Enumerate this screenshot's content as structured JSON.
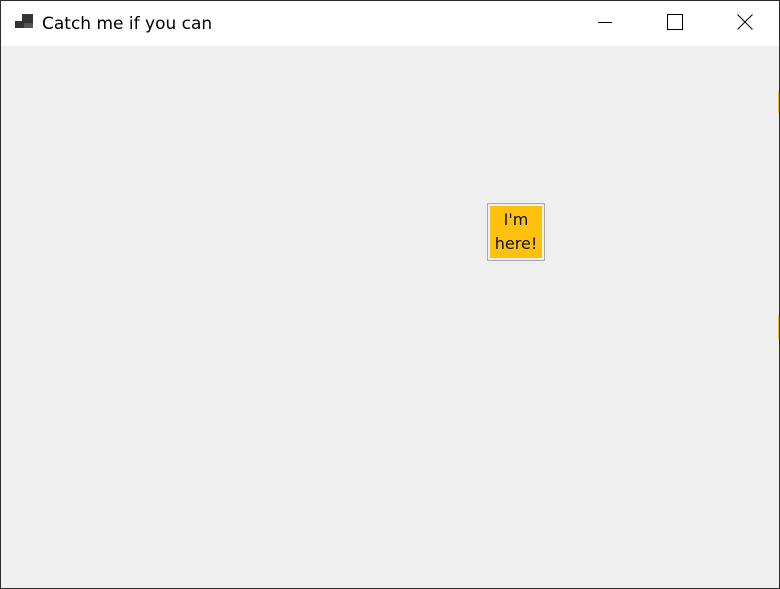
{
  "window": {
    "title": "Catch me if you can",
    "app_icon": "window-app-icon",
    "controls": {
      "minimize_icon": "minimize-icon",
      "maximize_icon": "maximize-icon",
      "close_icon": "close-icon"
    }
  },
  "main": {
    "catch_button_label": "I'm here!",
    "catch_button_color": "#ffc10e",
    "background_color": "#efefef"
  }
}
